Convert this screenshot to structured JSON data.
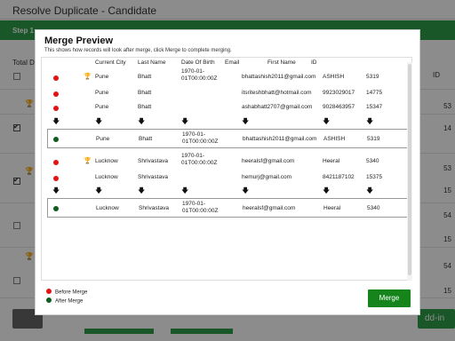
{
  "app": {
    "title": "Resolve Duplicate - Candidate",
    "step_label": "Step 1",
    "total_label": "Total D",
    "id_header": "ID",
    "right_numbers": [
      "53",
      "14",
      "53",
      "15",
      "54",
      "15",
      "54",
      "15"
    ],
    "addin_label": "dd-in",
    "colors": {
      "accent": "#2f9e4a"
    }
  },
  "modal": {
    "title": "Merge Preview",
    "subtitle": "This shows how records will look after merge, click Merge to complete merging.",
    "columns": [
      "Current City",
      "Last Name",
      "Date Of Birth",
      "Email",
      "First Name",
      "ID"
    ],
    "groups": [
      {
        "rows": [
          {
            "status": "before",
            "primary": true,
            "city": "Pune",
            "last": "Bhatt",
            "dob": "1970-01-01T00:00:00Z",
            "email": "bhattashish2011@gmail.com",
            "first": "ASHISH",
            "id": "5319"
          },
          {
            "status": "before",
            "primary": false,
            "city": "Pune",
            "last": "Bhatt",
            "dob": "",
            "email": "itsriteshbhatt@hotmail.com",
            "first": "9923029017",
            "id": "14775"
          },
          {
            "status": "before",
            "primary": false,
            "city": "Pune",
            "last": "Bhatt",
            "dob": "",
            "email": "ashabhatt2707@gmail.com",
            "first": "9028463957",
            "id": "15347"
          }
        ],
        "after": {
          "city": "Pune",
          "last": "Bhatt",
          "dob": "1970-01-01T00:00:00Z",
          "email": "bhattashish2011@gmail.com",
          "first": "ASHISH",
          "id": "5319"
        }
      },
      {
        "rows": [
          {
            "status": "before",
            "primary": true,
            "city": "Lucknow",
            "last": "Shrivastava",
            "dob": "1970-01-01T00:00:00Z",
            "email": "heeralsf@gmail.com",
            "first": "Heeral",
            "id": "5340"
          },
          {
            "status": "before",
            "primary": false,
            "city": "Lucknow",
            "last": "Shrivastava",
            "dob": "",
            "email": "hemurj@gmail.com",
            "first": "8421187102",
            "id": "15375"
          }
        ],
        "after": {
          "city": "Lucknow",
          "last": "Shrivastava",
          "dob": "1970-01-01T00:00:00Z",
          "email": "heeralsf@gmail.com",
          "first": "Heeral",
          "id": "5340"
        }
      }
    ],
    "legend": {
      "before": "Before Merge",
      "after": "After Merge"
    },
    "merge_button": "Merge",
    "colors": {
      "before_dot": "#e01414",
      "after_dot": "#0f5d1e",
      "merge_button": "#14841b"
    },
    "icons": {
      "primary": "trophy-icon",
      "arrow": "arrow-down-icon"
    }
  }
}
